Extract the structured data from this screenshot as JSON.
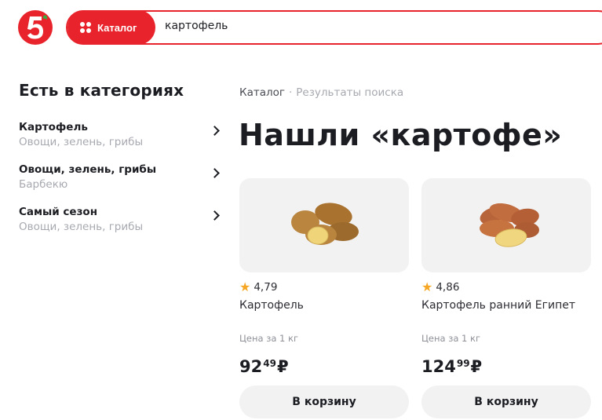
{
  "header": {
    "catalog_label": "Каталог",
    "search_value": "картофель",
    "brand_color": "#e8232b"
  },
  "sidebar": {
    "title": "Есть в категориях",
    "items": [
      {
        "label": "Картофель",
        "sub": "Овощи, зелень, грибы"
      },
      {
        "label": "Овощи, зелень, грибы",
        "sub": "Барбекю"
      },
      {
        "label": "Самый сезон",
        "sub": "Овощи, зелень, грибы"
      }
    ]
  },
  "breadcrumb": {
    "home": "Каталог",
    "separator": "·",
    "current": "Результаты поиска"
  },
  "main": {
    "title": "Нашли «картофе»"
  },
  "products": [
    {
      "rating": "4,79",
      "name": "Картофель",
      "unit_label": "Цена за 1 кг",
      "price_int": "92",
      "price_frac": "49",
      "currency": "₽",
      "cart_label": "В корзину"
    },
    {
      "rating": "4,86",
      "name": "Картофель ранний Египет",
      "unit_label": "Цена за 1 кг",
      "price_int": "124",
      "price_frac": "99",
      "currency": "₽",
      "cart_label": "В корзину"
    }
  ]
}
